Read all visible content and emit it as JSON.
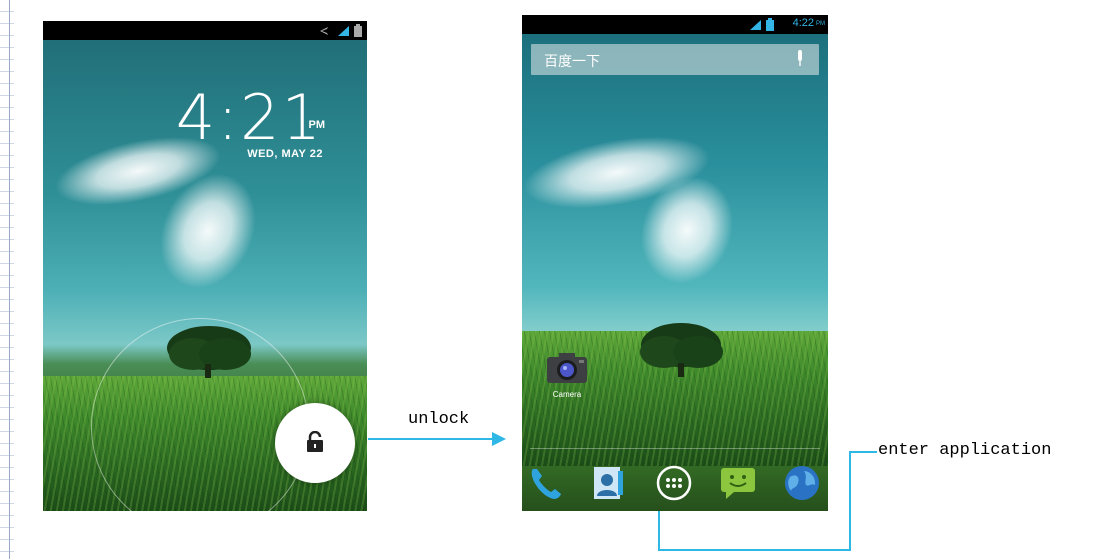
{
  "lock_screen": {
    "time": "4:21",
    "ampm": "PM",
    "date": "WED, MAY 22"
  },
  "home_screen": {
    "status_time": "4:22",
    "status_ampm": "PM",
    "search": {
      "placeholder": "百度一下"
    },
    "desktop_apps": [
      {
        "label": "Camera",
        "icon": "camera-icon"
      }
    ],
    "dock": [
      {
        "icon": "phone-icon"
      },
      {
        "icon": "contacts-icon"
      },
      {
        "icon": "app-drawer-icon"
      },
      {
        "icon": "messaging-icon"
      },
      {
        "icon": "browser-icon"
      }
    ]
  },
  "annotations": {
    "unlock": "unlock",
    "enter_application": "enter application"
  },
  "colors": {
    "arrow": "#2fb7e6",
    "status_bar": "#000000",
    "signal": "#33b5e5"
  }
}
